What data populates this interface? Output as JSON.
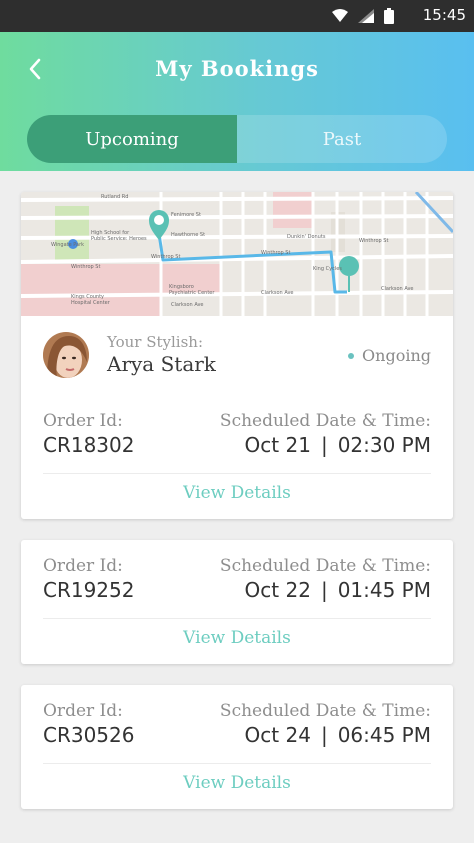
{
  "status_bar": {
    "time": "15:45"
  },
  "header": {
    "title": "My Bookings"
  },
  "tabs": [
    {
      "label": "Upcoming",
      "active": true
    },
    {
      "label": "Past",
      "active": false
    }
  ],
  "map": {
    "streets": [
      "Rutland Rd",
      "Fenimore St",
      "Hawthorne St",
      "Winthrop St",
      "Clarkson Ave",
      "Clarkson Ave",
      "E 49th St",
      "E 51st St",
      "E 53rd St",
      "E 54th St",
      "E 55th St",
      "E 56th St",
      "E 57th St",
      "E 58th St",
      "E 59th St",
      "Utica Ave",
      "Rochester Ave",
      "Winthrop St",
      "Clarkson Ave",
      "E 43rd St",
      "Kings Hwy"
    ],
    "places": [
      "High School for Public Service: Heroes",
      "Wingate Park",
      "Dunkin' Donuts",
      "King Cycles",
      "Kingsboro Psychiatric Center",
      "Kings County Hospital Center"
    ],
    "route_color": "#59b8e8",
    "pin_color": "#5ac1b4"
  },
  "bookings": [
    {
      "stylist_label": "Your Stylish:",
      "stylist_name": "Arya Stark",
      "status": "Ongoing",
      "order_label": "Order Id:",
      "order_id": "CR18302",
      "schedule_label": "Scheduled Date & Time:",
      "date": "Oct 21",
      "separator": "|",
      "time": "02:30 PM",
      "view_label": "View Details"
    },
    {
      "order_label": "Order Id:",
      "order_id": "CR19252",
      "schedule_label": "Scheduled Date & Time:",
      "date": "Oct 22",
      "separator": "|",
      "time": "01:45 PM",
      "view_label": "View Details"
    },
    {
      "order_label": "Order Id:",
      "order_id": "CR30526",
      "schedule_label": "Scheduled Date & Time:",
      "date": "Oct 24",
      "separator": "|",
      "time": "06:45 PM",
      "view_label": "View Details"
    }
  ],
  "colors": {
    "header_gradient_start": "#6fdc9e",
    "header_gradient_end": "#59bff0",
    "tab_active": "#3c9f78",
    "accent_link": "#6dcdc0",
    "status_dot": "#6ac2c0"
  }
}
